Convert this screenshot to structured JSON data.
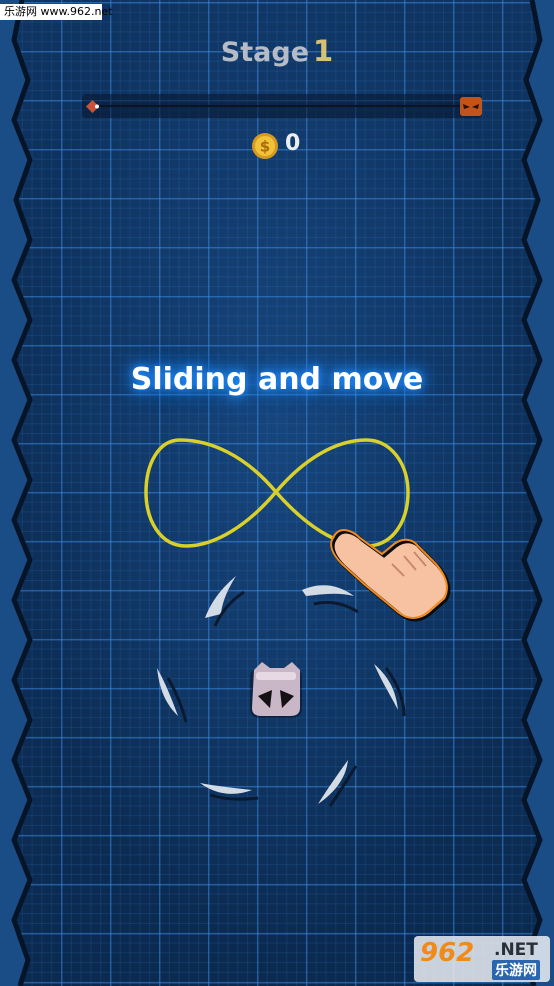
{
  "watermark_top_left": "乐游网 www.962.net",
  "hud": {
    "stage_label": "Stage",
    "stage_number": "1",
    "coin_count": "0"
  },
  "tutorial": {
    "instruction": "Sliding and move",
    "gesture": "infinity-swipe"
  },
  "watermark_bottom_right": {
    "brand": "962",
    "suffix": ".NET",
    "chinese": "乐游网"
  },
  "colors": {
    "background": "#0f3461",
    "grid": "#3c8ce6",
    "path": "#d9d02a",
    "hand_fill": "#f7c2a2",
    "hand_outline": "#f08a1e",
    "blade": "#d3dbe4",
    "stage_number": "#d8c173"
  },
  "icons": {
    "coin": "coin-icon",
    "player": "player-icon",
    "boss": "boss-icon",
    "hand": "hand-pointer-icon"
  }
}
